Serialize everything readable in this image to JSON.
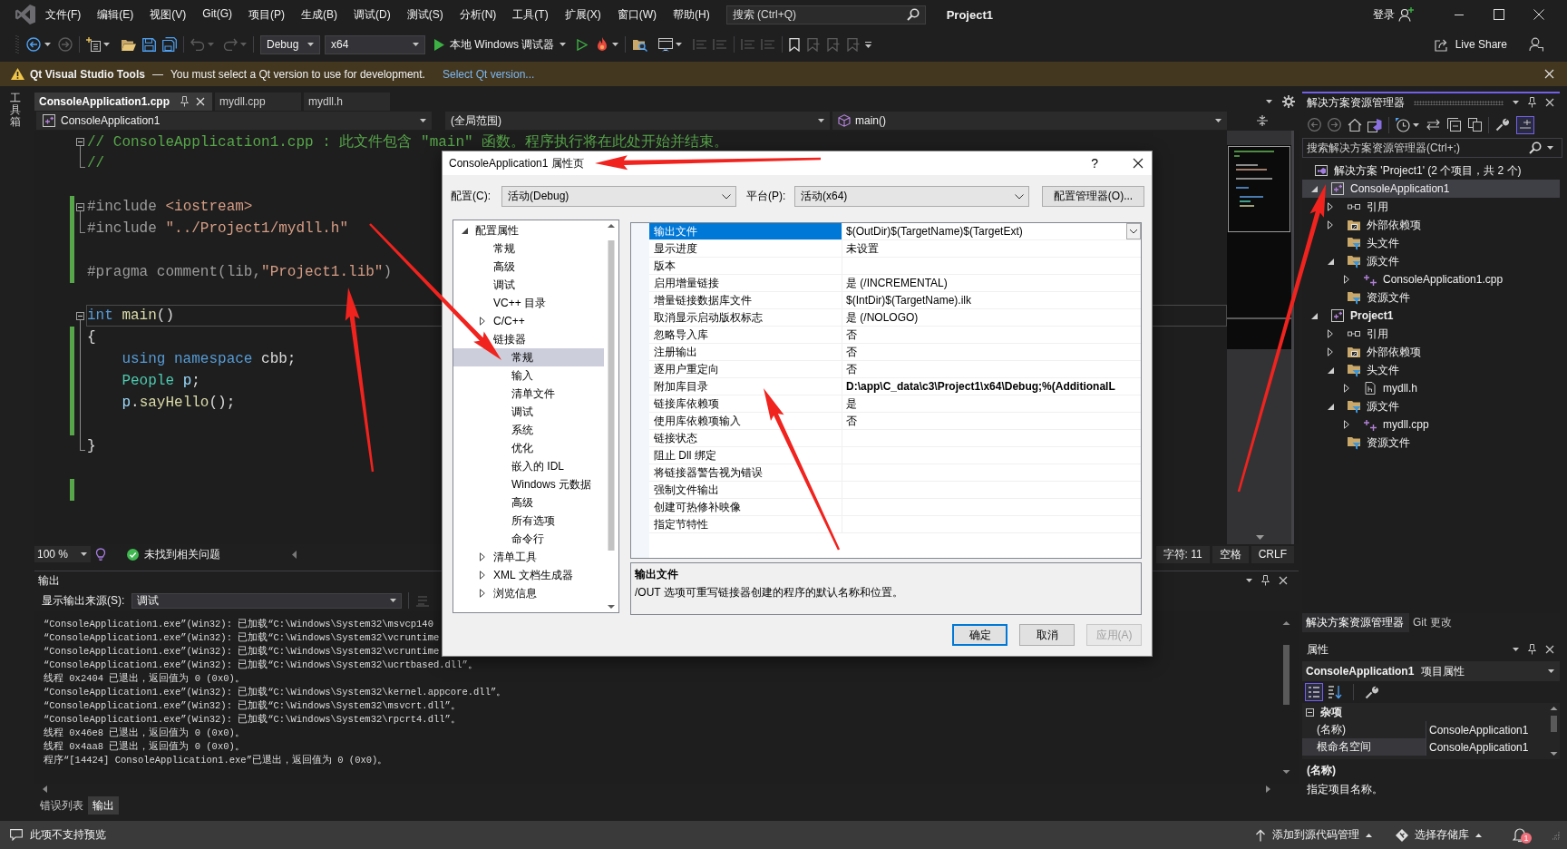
{
  "title_bar": {
    "menu": [
      "文件(F)",
      "编辑(E)",
      "视图(V)",
      "Git(G)",
      "项目(P)",
      "生成(B)",
      "调试(D)",
      "测试(S)",
      "分析(N)",
      "工具(T)",
      "扩展(X)",
      "窗口(W)",
      "帮助(H)"
    ],
    "search": {
      "placeholder": "搜索 (Ctrl+Q)"
    },
    "solution_name": "Project1",
    "sign_in": "登录"
  },
  "toolbar": {
    "configuration": "Debug",
    "platform": "x64",
    "debugger": "本地 Windows 调试器",
    "live_share": "Live Share"
  },
  "info_bar": {
    "product": "Qt Visual Studio Tools",
    "dash": "—",
    "message": "You must select a Qt version to use for development.",
    "link": "Select Qt version..."
  },
  "side_strip": {
    "label": "工具箱"
  },
  "document_tabs": [
    {
      "label": "ConsoleApplication1.cpp",
      "selected": true
    },
    {
      "label": "mydll.cpp",
      "selected": false
    },
    {
      "label": "mydll.h",
      "selected": false
    }
  ],
  "navigation_bar": {
    "project": "ConsoleApplication1",
    "scope": "(全局范围)",
    "member": "main()"
  },
  "editor": {
    "lines": [
      {
        "kind": "opener",
        "changed": false,
        "current": false,
        "tokens": [
          {
            "kind": "comment",
            "text": "// ConsoleApplication1.cpp : 此文件包含 \"main\" 函数。程序执行将在此处开始并结束。"
          }
        ]
      },
      {
        "kind": "closer",
        "changed": false,
        "current": false,
        "tokens": [
          {
            "kind": "comment",
            "text": "//"
          }
        ]
      },
      {
        "kind": "plain",
        "changed": false,
        "current": false
      },
      {
        "kind": "opener",
        "changed": true,
        "current": false,
        "tokens": [
          {
            "kind": "preprocessor",
            "text": "#include "
          },
          {
            "kind": "string",
            "text": "<iostream>"
          }
        ]
      },
      {
        "kind": "closer",
        "changed": true,
        "current": false,
        "tokens": [
          {
            "kind": "preprocessor",
            "text": "#include "
          },
          {
            "kind": "string",
            "text": "\"../Project1/mydll.h\""
          }
        ]
      },
      {
        "kind": "plain",
        "changed": true,
        "current": false
      },
      {
        "kind": "plain",
        "changed": true,
        "current": false,
        "tokens": [
          {
            "kind": "preprocessor",
            "text": "#pragma comment(lib,"
          },
          {
            "kind": "string",
            "text": "\"Project1.lib\""
          },
          {
            "kind": "preprocessor",
            "text": ")"
          }
        ]
      },
      {
        "kind": "plain",
        "changed": false,
        "current": false
      },
      {
        "kind": "opener",
        "changed": false,
        "current": true,
        "tokens": [
          {
            "kind": "keyword",
            "text": "int "
          },
          {
            "kind": "function",
            "text": "main"
          },
          {
            "kind": "plain",
            "text": "()"
          }
        ]
      },
      {
        "kind": "inside",
        "changed": true,
        "current": false,
        "tokens": [
          {
            "kind": "plain",
            "text": "{"
          }
        ]
      },
      {
        "kind": "inside",
        "changed": true,
        "current": false,
        "tokens": [
          {
            "kind": "keyword",
            "text": "    using namespace "
          },
          {
            "kind": "plain",
            "text": "cbb;"
          }
        ]
      },
      {
        "kind": "inside",
        "changed": true,
        "current": false,
        "tokens": [
          {
            "kind": "type",
            "text": "    People "
          },
          {
            "kind": "variable",
            "text": "p"
          },
          {
            "kind": "plain",
            "text": ";"
          }
        ]
      },
      {
        "kind": "inside",
        "changed": true,
        "current": false,
        "tokens": [
          {
            "kind": "variable",
            "text": "    p"
          },
          {
            "kind": "plain",
            "text": "."
          },
          {
            "kind": "function",
            "text": "sayHello"
          },
          {
            "kind": "plain",
            "text": "();"
          }
        ]
      },
      {
        "kind": "inside",
        "changed": true,
        "current": false
      },
      {
        "kind": "closer",
        "changed": false,
        "current": false,
        "tokens": [
          {
            "kind": "plain",
            "text": "}"
          }
        ]
      },
      {
        "kind": "plain",
        "changed": false,
        "current": false
      },
      {
        "kind": "plain",
        "changed": true,
        "current": false
      }
    ]
  },
  "editor_status": {
    "zoom": "100 %",
    "issues": "未找到相关问题",
    "position": "字符: 11",
    "indent": "空格",
    "line_ending": "CRLF"
  },
  "output": {
    "title": "输出",
    "source_label": "显示输出来源(S):",
    "source": "调试",
    "lines": [
      "“ConsoleApplication1.exe”(Win32): 已加载“C:\\Windows\\System32\\msvcp140",
      "“ConsoleApplication1.exe”(Win32): 已加载“C:\\Windows\\System32\\vcruntime",
      "“ConsoleApplication1.exe”(Win32): 已加载“C:\\Windows\\System32\\vcruntime",
      "“ConsoleApplication1.exe”(Win32): 已加载“C:\\Windows\\System32\\ucrtbased.dll”。",
      "线程 0x2404 已退出，返回值为 0 (0x0)。",
      "“ConsoleApplication1.exe”(Win32): 已加载“C:\\Windows\\System32\\kernel.appcore.dll”。",
      "“ConsoleApplication1.exe”(Win32): 已加载“C:\\Windows\\System32\\msvcrt.dll”。",
      "“ConsoleApplication1.exe”(Win32): 已加载“C:\\Windows\\System32\\rpcrt4.dll”。",
      "线程 0x46e8 已退出，返回值为 0 (0x0)。",
      "线程 0x4aa8 已退出，返回值为 0 (0x0)。",
      "程序“[14424] ConsoleApplication1.exe”已退出，返回值为 0 (0x0)。"
    ]
  },
  "panel_tabs": [
    {
      "label": "错误列表",
      "selected": false
    },
    {
      "label": "输出",
      "selected": true
    }
  ],
  "dialog": {
    "title": "ConsoleApplication1 属性页",
    "help": "?",
    "configuration_label": "配置(C):",
    "configuration": "活动(Debug)",
    "platform_label": "平台(P):",
    "platform": "活动(x64)",
    "manager_button": "配置管理器(O)...",
    "tree": [
      {
        "label": "配置属性",
        "expanded": true,
        "selected": false,
        "children": [
          {
            "label": "常规",
            "selected": false
          },
          {
            "label": "高级",
            "selected": false
          },
          {
            "label": "调试",
            "selected": false
          },
          {
            "label": "VC++ 目录",
            "selected": false
          },
          {
            "label": "C/C++",
            "expanded": false,
            "selected": false
          },
          {
            "label": "链接器",
            "expanded": true,
            "selected": false,
            "children": [
              {
                "label": "常规",
                "selected": true
              },
              {
                "label": "输入",
                "selected": false
              },
              {
                "label": "清单文件",
                "selected": false
              },
              {
                "label": "调试",
                "selected": false
              },
              {
                "label": "系统",
                "selected": false
              },
              {
                "label": "优化",
                "selected": false
              },
              {
                "label": "嵌入的 IDL",
                "selected": false
              },
              {
                "label": "Windows 元数据",
                "selected": false
              },
              {
                "label": "高级",
                "selected": false
              },
              {
                "label": "所有选项",
                "selected": false
              },
              {
                "label": "命令行",
                "selected": false
              }
            ]
          },
          {
            "label": "清单工具",
            "expanded": false,
            "selected": false
          },
          {
            "label": "XML 文档生成器",
            "expanded": false,
            "selected": false
          },
          {
            "label": "浏览信息",
            "expanded": false,
            "selected": false
          }
        ]
      }
    ],
    "properties": [
      {
        "name": "输出文件",
        "value": "$(OutDir)$(TargetName)$(TargetExt)",
        "selected": true,
        "overridden": false
      },
      {
        "name": "显示进度",
        "value": "未设置",
        "selected": false,
        "overridden": false
      },
      {
        "name": "版本",
        "selected": false
      },
      {
        "name": "启用增量链接",
        "value": "是 (/INCREMENTAL)",
        "selected": false,
        "overridden": false
      },
      {
        "name": "增量链接数据库文件",
        "value": "$(IntDir)$(TargetName).ilk",
        "selected": false,
        "overridden": false
      },
      {
        "name": "取消显示启动版权标志",
        "value": "是 (/NOLOGO)",
        "selected": false,
        "overridden": false
      },
      {
        "name": "忽略导入库",
        "value": "否",
        "selected": false,
        "overridden": false
      },
      {
        "name": "注册输出",
        "value": "否",
        "selected": false,
        "overridden": false
      },
      {
        "name": "逐用户重定向",
        "value": "否",
        "selected": false,
        "overridden": false
      },
      {
        "name": "附加库目录",
        "value": "D:\\app\\C_data\\c3\\Project1\\x64\\Debug;%(AdditionalL",
        "selected": false,
        "overridden": true
      },
      {
        "name": "链接库依赖项",
        "value": "是",
        "selected": false,
        "overridden": false
      },
      {
        "name": "使用库依赖项输入",
        "value": "否",
        "selected": false,
        "overridden": false
      },
      {
        "name": "链接状态",
        "selected": false
      },
      {
        "name": "阻止 Dll 绑定",
        "selected": false
      },
      {
        "name": "将链接器警告视为错误",
        "selected": false
      },
      {
        "name": "强制文件输出",
        "selected": false
      },
      {
        "name": "创建可热修补映像",
        "selected": false
      },
      {
        "name": "指定节特性",
        "selected": false
      }
    ],
    "description": {
      "title": "输出文件",
      "text": "/OUT 选项可重写链接器创建的程序的默认名称和位置。"
    },
    "buttons": [
      {
        "label": "确定",
        "default": true,
        "disabled": false
      },
      {
        "label": "取消",
        "default": false,
        "disabled": false
      },
      {
        "label": "应用(A)",
        "default": false,
        "disabled": true
      }
    ]
  },
  "solution_explorer": {
    "title": "解决方案资源管理器",
    "search": {
      "placeholder": "搜索解决方案资源管理器(Ctrl+;)"
    },
    "tree": [
      {
        "kind": "solution",
        "label": "解决方案 'Project1' (2 个项目，共 2 个)",
        "selected": false,
        "children": [
          {
            "kind": "project",
            "label": "ConsoleApplication1",
            "expanded": true,
            "selected": true,
            "startup": false,
            "children": [
              {
                "kind": "references",
                "label": "引用",
                "expanded": false,
                "selected": false
              },
              {
                "kind": "external",
                "label": "外部依赖项",
                "expanded": false,
                "selected": false
              },
              {
                "kind": "filter",
                "label": "头文件",
                "selected": false
              },
              {
                "kind": "filter",
                "label": "源文件",
                "expanded": true,
                "selected": false,
                "children": [
                  {
                    "kind": "cpp",
                    "label": "ConsoleApplication1.cpp",
                    "expanded": false,
                    "selected": false
                  }
                ]
              },
              {
                "kind": "filter",
                "label": "资源文件",
                "selected": false
              }
            ]
          },
          {
            "kind": "project",
            "label": "Project1",
            "expanded": true,
            "selected": false,
            "startup": true,
            "children": [
              {
                "kind": "references",
                "label": "引用",
                "expanded": false,
                "selected": false
              },
              {
                "kind": "external",
                "label": "外部依赖项",
                "expanded": false,
                "selected": false
              },
              {
                "kind": "filter",
                "label": "头文件",
                "expanded": true,
                "selected": false,
                "children": [
                  {
                    "kind": "header",
                    "label": "mydll.h",
                    "expanded": false,
                    "selected": false
                  }
                ]
              },
              {
                "kind": "filter",
                "label": "源文件",
                "expanded": true,
                "selected": false,
                "children": [
                  {
                    "kind": "cpp",
                    "label": "mydll.cpp",
                    "expanded": false,
                    "selected": false
                  }
                ]
              },
              {
                "kind": "filter",
                "label": "资源文件",
                "selected": false
              }
            ]
          }
        ]
      }
    ],
    "tabs": [
      {
        "label": "解决方案资源管理器",
        "selected": true
      },
      {
        "label": "Git 更改",
        "selected": false
      }
    ]
  },
  "properties_panel": {
    "title": "属性",
    "object_name": "ConsoleApplication1",
    "object_type": "项目属性",
    "category": {
      "label": "杂项",
      "expanded": true
    },
    "rows": [
      {
        "name": "(名称)",
        "value": "ConsoleApplication1",
        "selected": false
      },
      {
        "name": "根命名空间",
        "value": "ConsoleApplication1",
        "selected": true
      }
    ],
    "description": {
      "title": "(名称)",
      "text": "指定项目名称。"
    }
  },
  "status_bar": {
    "message": "此项不支持预览",
    "source_control": "添加到源代码管理",
    "repository": "选择存储库",
    "notifications": "1"
  }
}
